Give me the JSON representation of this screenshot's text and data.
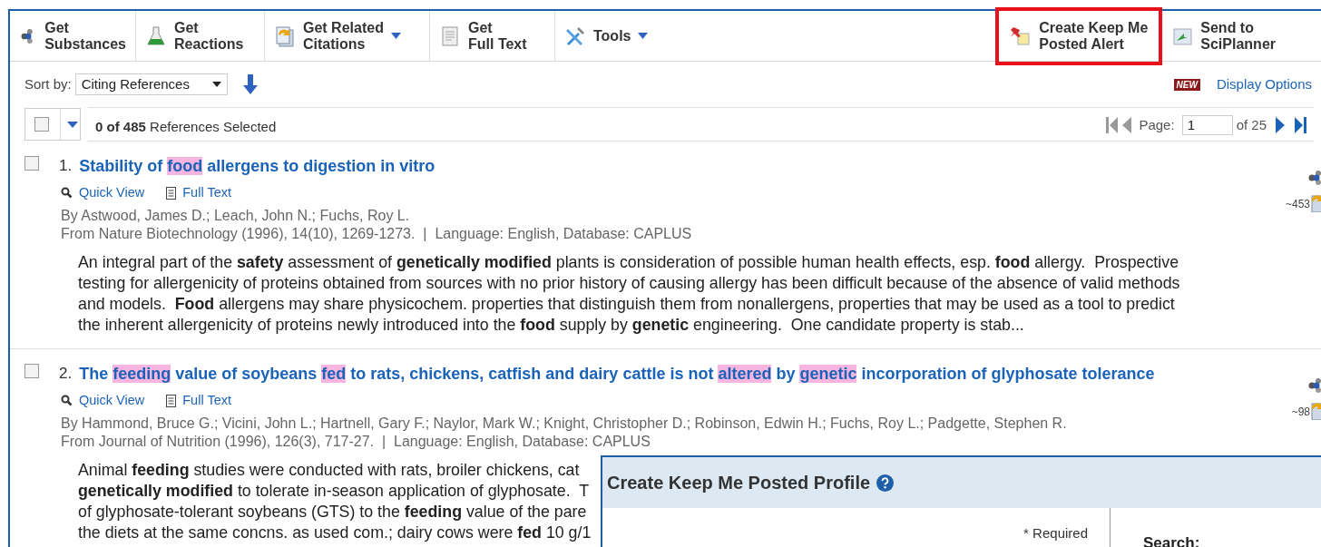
{
  "toolbar": {
    "left": [
      {
        "kind": "substances",
        "lines": [
          "Get",
          "Substances"
        ],
        "dropdown": false,
        "highlighted": false
      },
      {
        "kind": "reactions",
        "lines": [
          "Get",
          "Reactions"
        ],
        "dropdown": false,
        "highlighted": false
      },
      {
        "kind": "citations",
        "lines": [
          "Get Related",
          "Citations"
        ],
        "dropdown": true,
        "highlighted": false
      },
      {
        "kind": "fulltext",
        "lines": [
          "Get",
          "Full Text"
        ],
        "dropdown": false,
        "highlighted": false
      },
      {
        "kind": "tools",
        "lines": [
          "Tools"
        ],
        "dropdown": true,
        "highlighted": false
      }
    ],
    "right": [
      {
        "kind": "alert",
        "lines": [
          "Create Keep Me",
          "Posted Alert"
        ],
        "dropdown": false,
        "highlighted": true
      },
      {
        "kind": "planner",
        "lines": [
          "Send to",
          "SciPlanner"
        ],
        "dropdown": false,
        "highlighted": false
      }
    ]
  },
  "sort": {
    "label": "Sort by:",
    "value": "Citing References"
  },
  "new_badge": "NEW",
  "display_options": "Display Options",
  "selection": {
    "checked": false,
    "summary": "**0 of 485** References Selected"
  },
  "pagination": {
    "label": "Page:",
    "value": "1",
    "total": "of 25"
  },
  "references": [
    {
      "number": "1.",
      "checked": false,
      "title": [
        {
          "text": "Stability of ",
          "highlight": false
        },
        {
          "text": "food",
          "highlight": true
        },
        {
          "text": " allergens to digestion in vitro",
          "highlight": false
        }
      ],
      "links": [
        "Quick View",
        "Full Text"
      ],
      "authors": "By Astwood, James D.; Leach, John N.; Fuchs, Roy L.",
      "source": "From Nature Biotechnology (1996), 14(10), 1269-1273.  |  Language: English, Database: CAPLUS",
      "abstract": [
        "An integral part of the **safety** assessment of **genetically modified** plants is consideration of possible human health effects, esp. **food** allergy.  Prospective",
        "testing for allergenicity of proteins obtained from sources with no prior history of causing allergy has been difficult because of the absence of valid methods",
        "and models.  **Food** allergens may share physicochem. properties that distinguish them from nonallergens, properties that may be used as a tool to predict",
        "the inherent allergenicity of proteins newly introduced into the **food** supply by **genetic** engineering.  One candidate property is stab..."
      ],
      "count": "~453"
    },
    {
      "number": "2.",
      "checked": false,
      "title": [
        {
          "text": "The ",
          "highlight": false
        },
        {
          "text": "feeding",
          "highlight": true
        },
        {
          "text": " value of soybeans ",
          "highlight": false
        },
        {
          "text": "fed",
          "highlight": true
        },
        {
          "text": " to rats, chickens, catfish and dairy cattle is not ",
          "highlight": false
        },
        {
          "text": "altered",
          "highlight": true
        },
        {
          "text": " by ",
          "highlight": false
        },
        {
          "text": "genetic",
          "highlight": true
        },
        {
          "text": " incorporation of glyphosate tolerance",
          "highlight": false
        }
      ],
      "links": [
        "Quick View",
        "Full Text"
      ],
      "authors": "By Hammond, Bruce G.; Vicini, John L.; Hartnell, Gary F.; Naylor, Mark W.; Knight, Christopher D.; Robinson, Edwin H.; Fuchs, Roy L.; Padgette, Stephen R.",
      "source": "From Journal of Nutrition (1996), 126(3), 717-27.  |  Language: English, Database: CAPLUS",
      "abstract": [
        "Animal **feeding** studies were conducted with rats, broiler chickens, cat",
        "**genetically modified** to tolerate in-season application of glyphosate.  T",
        "of glyphosate-tolerant soybeans (GTS) to the **feeding** value of the pare",
        "the diets at the same concns. as used com.; dairy cows were **fed** 10 g/1"
      ],
      "count": "~98"
    }
  ],
  "dialog": {
    "title": "Create Keep Me Posted Profile",
    "required": "* Required",
    "search_label": "Search:"
  }
}
